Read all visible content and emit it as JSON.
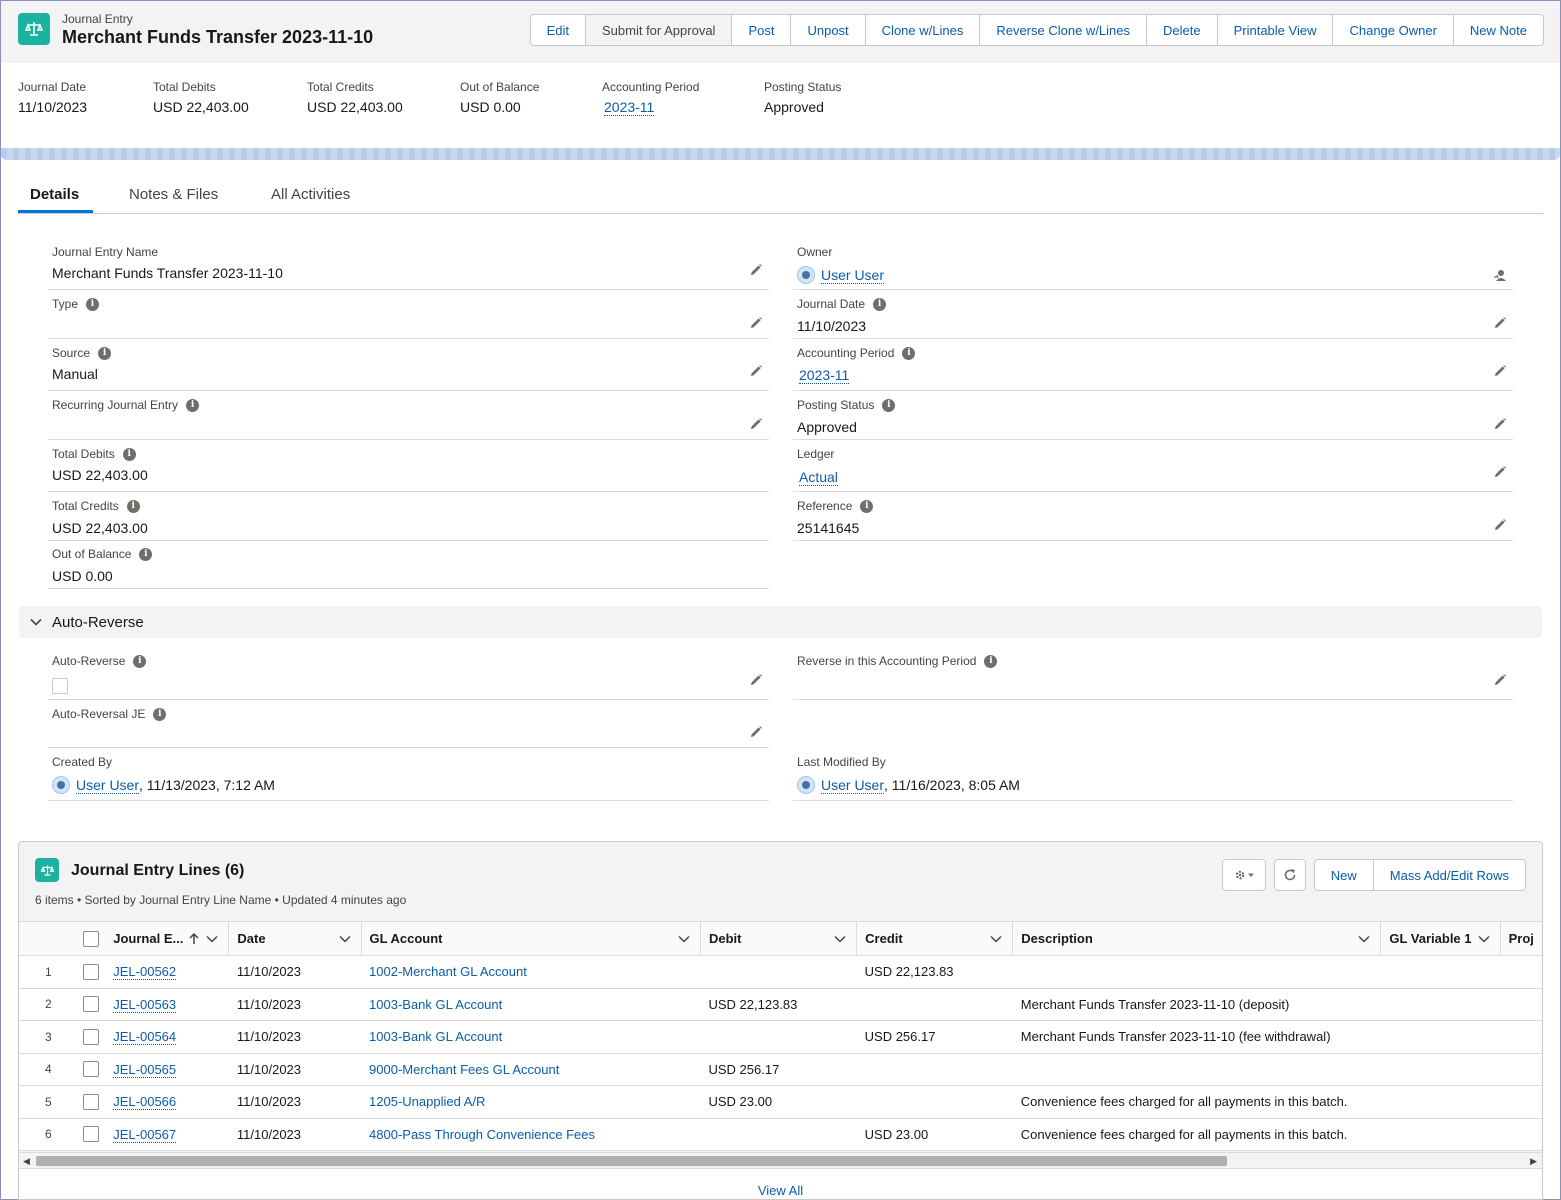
{
  "header": {
    "object_label": "Journal Entry",
    "record_title": "Merchant Funds Transfer 2023-11-10",
    "actions": [
      "Edit",
      "Submit for Approval",
      "Post",
      "Unpost",
      "Clone w/Lines",
      "Reverse Clone w/Lines",
      "Delete",
      "Printable View",
      "Change Owner",
      "New Note"
    ]
  },
  "highlights": [
    {
      "label": "Journal Date",
      "value": "11/10/2023"
    },
    {
      "label": "Total Debits",
      "value": "USD 22,403.00"
    },
    {
      "label": "Total Credits",
      "value": "USD 22,403.00"
    },
    {
      "label": "Out of Balance",
      "value": "USD 0.00"
    },
    {
      "label": "Accounting Period",
      "value": "2023-11"
    },
    {
      "label": "Posting Status",
      "value": "Approved"
    }
  ],
  "tabs": [
    "Details",
    "Notes & Files",
    "All Activities"
  ],
  "details": {
    "journal_entry_name": {
      "label": "Journal Entry Name",
      "value": "Merchant Funds Transfer 2023-11-10"
    },
    "type": {
      "label": "Type",
      "value": ""
    },
    "source": {
      "label": "Source",
      "value": "Manual"
    },
    "recurring": {
      "label": "Recurring Journal Entry",
      "value": ""
    },
    "total_debits": {
      "label": "Total Debits",
      "value": "USD 22,403.00"
    },
    "total_credits": {
      "label": "Total Credits",
      "value": "USD 22,403.00"
    },
    "out_of_balance": {
      "label": "Out of Balance",
      "value": "USD 0.00"
    },
    "owner": {
      "label": "Owner",
      "value": "User User"
    },
    "journal_date": {
      "label": "Journal Date",
      "value": "11/10/2023"
    },
    "accounting_period": {
      "label": "Accounting Period",
      "value": "2023-11"
    },
    "posting_status": {
      "label": "Posting Status",
      "value": "Approved"
    },
    "ledger": {
      "label": "Ledger",
      "value": "Actual"
    },
    "reference": {
      "label": "Reference",
      "value": "25141645"
    }
  },
  "auto_reverse": {
    "section_title": "Auto-Reverse",
    "auto_reverse_label": "Auto-Reverse",
    "auto_reversal_je_label": "Auto-Reversal JE",
    "reverse_period_label": "Reverse in this Accounting Period",
    "created_by_label": "Created By",
    "created_by_user": "User User",
    "created_by_date": ", 11/13/2023, 7:12 AM",
    "modified_by_label": "Last Modified By",
    "modified_by_user": "User User",
    "modified_by_date": ", 11/16/2023, 8:05 AM"
  },
  "related_list": {
    "title": "Journal Entry Lines (6)",
    "subtitle": "6 items • Sorted by Journal Entry Line Name • Updated 4 minutes ago",
    "new_label": "New",
    "mass_label": "Mass Add/Edit Rows",
    "view_all": "View All",
    "columns": [
      "Journal E...",
      "Date",
      "GL Account",
      "Debit",
      "Credit",
      "Description",
      "GL Variable 1",
      "Proj"
    ],
    "rows": [
      {
        "num": "1",
        "name": "JEL-00562",
        "date": "11/10/2023",
        "gl": "1002-Merchant GL Account",
        "debit": "",
        "credit": "USD 22,123.83",
        "desc": ""
      },
      {
        "num": "2",
        "name": "JEL-00563",
        "date": "11/10/2023",
        "gl": "1003-Bank GL Account",
        "debit": "USD 22,123.83",
        "credit": "",
        "desc": "Merchant Funds Transfer 2023-11-10 (deposit)"
      },
      {
        "num": "3",
        "name": "JEL-00564",
        "date": "11/10/2023",
        "gl": "1003-Bank GL Account",
        "debit": "",
        "credit": "USD 256.17",
        "desc": "Merchant Funds Transfer 2023-11-10 (fee withdrawal)"
      },
      {
        "num": "4",
        "name": "JEL-00565",
        "date": "11/10/2023",
        "gl": "9000-Merchant Fees GL Account",
        "debit": "USD 256.17",
        "credit": "",
        "desc": ""
      },
      {
        "num": "5",
        "name": "JEL-00566",
        "date": "11/10/2023",
        "gl": "1205-Unapplied A/R",
        "debit": "USD 23.00",
        "credit": "",
        "desc": "Convenience fees charged for all payments in this batch."
      },
      {
        "num": "6",
        "name": "JEL-00567",
        "date": "11/10/2023",
        "gl": "4800-Pass Through Convenience Fees",
        "debit": "",
        "credit": "USD 23.00",
        "desc": "Convenience fees charged for all payments in this batch."
      }
    ]
  },
  "colors": {
    "accent": "#0176d3",
    "link": "#0b5cab",
    "object_icon": "#1ab39f"
  },
  "icons": [
    "journal-entry-icon",
    "pencil-icon",
    "info-icon",
    "chevron-down-icon",
    "gear-icon",
    "refresh-icon",
    "change-owner-icon",
    "sort-up-icon"
  ]
}
